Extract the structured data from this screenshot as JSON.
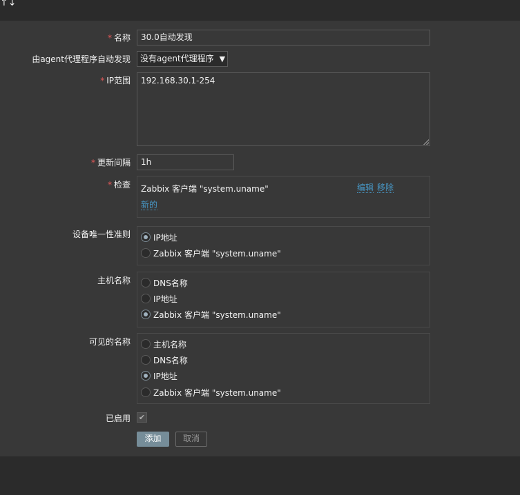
{
  "topbar": {
    "glyph": "↑↓"
  },
  "form": {
    "name": {
      "label": "名称",
      "value": "30.0自动发现"
    },
    "proxy": {
      "label": "由agent代理程序自动发现",
      "selected": "没有agent代理程序",
      "arrow": "▼"
    },
    "ip_range": {
      "label": "IP范围",
      "value": "192.168.30.1-254"
    },
    "delay": {
      "label": "更新间隔",
      "value": "1h"
    },
    "checks": {
      "label": "检查",
      "items": [
        {
          "text": "Zabbix 客户端 \"system.uname\"",
          "edit": "编辑",
          "remove": "移除"
        }
      ],
      "new_link": "新的"
    },
    "uniqueness": {
      "label": "设备唯一性准则",
      "options": [
        {
          "label": "IP地址",
          "checked": true
        },
        {
          "label": "Zabbix 客户端 \"system.uname\"",
          "checked": false
        }
      ]
    },
    "host_name": {
      "label": "主机名称",
      "options": [
        {
          "label": "DNS名称",
          "checked": false
        },
        {
          "label": "IP地址",
          "checked": false
        },
        {
          "label": "Zabbix 客户端 \"system.uname\"",
          "checked": true
        }
      ]
    },
    "visible_name": {
      "label": "可见的名称",
      "options": [
        {
          "label": "主机名称",
          "checked": false
        },
        {
          "label": "DNS名称",
          "checked": false
        },
        {
          "label": "IP地址",
          "checked": true
        },
        {
          "label": "Zabbix 客户端 \"system.uname\"",
          "checked": false
        }
      ]
    },
    "enabled": {
      "label": "已启用",
      "checked": true,
      "mark": "✔"
    },
    "required_mark": "*"
  },
  "buttons": {
    "add": "添加",
    "cancel": "取消"
  },
  "colors": {
    "panel": "#383838",
    "background": "#2b2b2b",
    "link": "#4796c4",
    "primary": "#768d99",
    "required": "#e45959"
  }
}
